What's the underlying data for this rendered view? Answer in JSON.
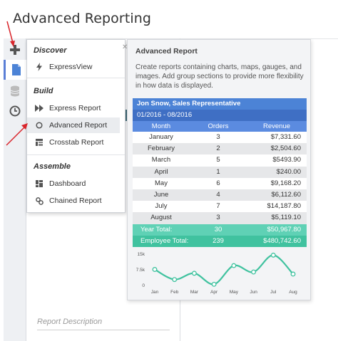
{
  "app": {
    "title": "Advanced Reporting"
  },
  "rail": {
    "items": [
      {
        "icon": "plus-icon"
      },
      {
        "icon": "document-icon"
      },
      {
        "icon": "database-icon"
      },
      {
        "icon": "clock-icon"
      }
    ]
  },
  "menu": {
    "sections": [
      {
        "title": "Discover",
        "items": [
          {
            "label": "ExpressView",
            "icon": "lightning-icon"
          }
        ]
      },
      {
        "title": "Build",
        "items": [
          {
            "label": "Express Report",
            "icon": "fast-forward-icon"
          },
          {
            "label": "Advanced Report",
            "icon": "circle-icon"
          },
          {
            "label": "Crosstab Report",
            "icon": "table-icon"
          }
        ]
      },
      {
        "title": "Assemble",
        "items": [
          {
            "label": "Dashboard",
            "icon": "dashboard-icon"
          },
          {
            "label": "Chained Report",
            "icon": "link-icon"
          }
        ]
      }
    ]
  },
  "panel": {
    "title": "Advanced Report",
    "description": "Create reports containing charts, maps, gauges, and images. Add group sections to provide more flexibility in how data is displayed.",
    "report": {
      "header": "Jon Snow, Sales Representative",
      "period": "01/2016 - 08/2016",
      "columns": [
        "Month",
        "Orders",
        "Revenue"
      ],
      "rows": [
        [
          "January",
          "3",
          "$7,331.60"
        ],
        [
          "February",
          "2",
          "$2,504.60"
        ],
        [
          "March",
          "5",
          "$5493.90"
        ],
        [
          "April",
          "1",
          "$240.00"
        ],
        [
          "May",
          "6",
          "$9,168.20"
        ],
        [
          "June",
          "4",
          "$6,112.60"
        ],
        [
          "July",
          "7",
          "$14,187.80"
        ],
        [
          "August",
          "3",
          "$5,119.10"
        ]
      ],
      "year_total": [
        "Year Total:",
        "30",
        "$50,967.80"
      ],
      "employee_total": [
        "Employee Total:",
        "239",
        "$480,742.60"
      ]
    }
  },
  "chart_data": {
    "type": "line",
    "categories": [
      "Jan",
      "Feb",
      "Mar",
      "Apr",
      "May",
      "Jun",
      "Jul",
      "Aug"
    ],
    "values": [
      7331.6,
      2504.6,
      5493.9,
      240.0,
      9168.2,
      6112.6,
      14187.8,
      5119.1
    ],
    "y_ticks": [
      "15k",
      "7.5k",
      "0"
    ],
    "ylim": [
      0,
      15000
    ],
    "color": "#40c29f"
  },
  "main": {
    "report_description_placeholder": "Report Description"
  },
  "colors": {
    "accent": "#4c83d6",
    "total": "#40c29f",
    "arrow": "#d9262c"
  }
}
